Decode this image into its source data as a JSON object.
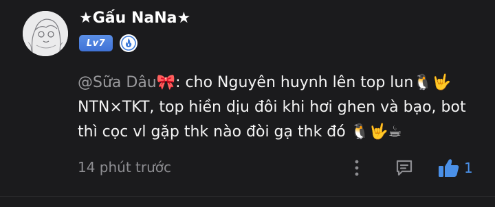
{
  "user": {
    "name": "★Gấu NaNa★",
    "level": "Lv7",
    "avatar_icon": "sketch-avatar-icon",
    "rank_icon": "blue-flame-rank-icon"
  },
  "comment": {
    "mention": "@Sữa Dâu🎀",
    "line1_text": ": cho Nguyên huynh lên top lun🐧🤟",
    "line2_text": "NTN×TKT, top hiền dịu đôi khi hơi ghen và bạo, bot",
    "line3_text": "thì cọc vl gặp thk nào đòi gạ thk đó 🐧🤟☕"
  },
  "meta": {
    "time": "14 phút trước",
    "like_count": "1"
  },
  "colors": {
    "background": "#1b1b1d",
    "accent_blue": "#4a90e8",
    "level_badge": "#4a80dd",
    "muted_text": "#8e8e92"
  }
}
